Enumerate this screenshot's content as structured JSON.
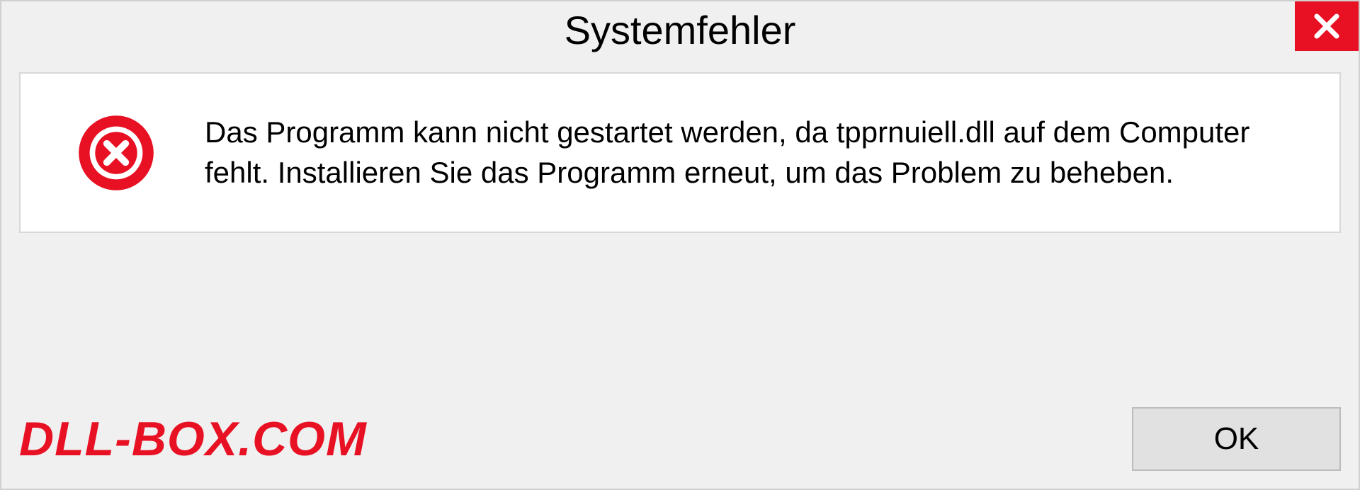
{
  "title": "Systemfehler",
  "message": "Das Programm kann nicht gestartet werden, da tpprnuiell.dll auf dem Computer fehlt. Installieren Sie das Programm erneut, um das Problem zu beheben.",
  "watermark": "DLL-BOX.COM",
  "ok_label": "OK"
}
